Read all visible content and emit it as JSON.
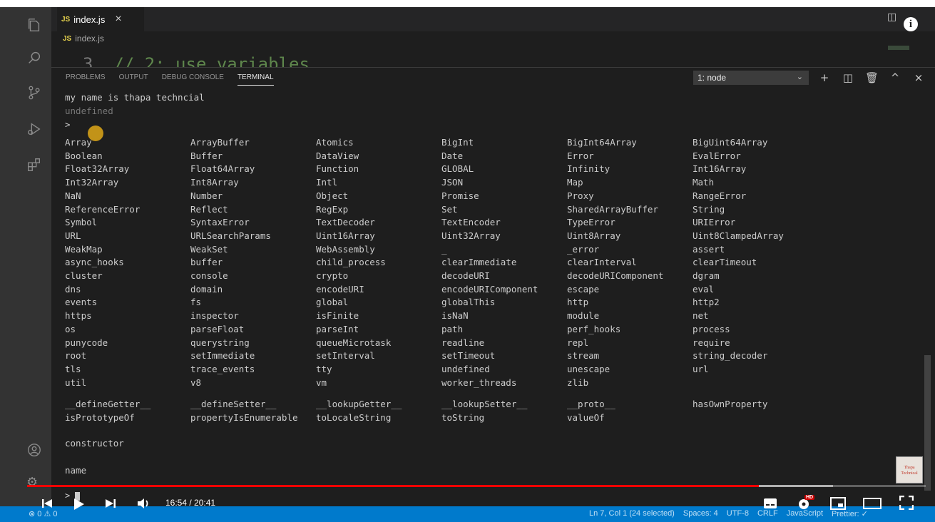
{
  "editor": {
    "tab_label": "index.js",
    "tab_lang_badge": "JS",
    "tab_close": "×",
    "breadcrumb": "index.js",
    "peek_line_number": "3",
    "peek_code": "// 2: use variables"
  },
  "panel": {
    "tabs": [
      "PROBLEMS",
      "OUTPUT",
      "DEBUG CONSOLE",
      "TERMINAL"
    ],
    "active_tab": "TERMINAL",
    "terminal_select": "1: node",
    "actions": [
      "+",
      "split",
      "trash",
      "^",
      "×"
    ]
  },
  "terminal": {
    "output_line": "my name is thapa techncial",
    "undefined_line": "undefined",
    "prompt": ">",
    "completion_grid": [
      [
        "Array",
        "ArrayBuffer",
        "Atomics",
        "BigInt",
        "BigInt64Array",
        "BigUint64Array"
      ],
      [
        "Boolean",
        "Buffer",
        "DataView",
        "Date",
        "Error",
        "EvalError"
      ],
      [
        "Float32Array",
        "Float64Array",
        "Function",
        "GLOBAL",
        "Infinity",
        "Int16Array"
      ],
      [
        "Int32Array",
        "Int8Array",
        "Intl",
        "JSON",
        "Map",
        "Math"
      ],
      [
        "NaN",
        "Number",
        "Object",
        "Promise",
        "Proxy",
        "RangeError"
      ],
      [
        "ReferenceError",
        "Reflect",
        "RegExp",
        "Set",
        "SharedArrayBuffer",
        "String"
      ],
      [
        "Symbol",
        "SyntaxError",
        "TextDecoder",
        "TextEncoder",
        "TypeError",
        "URIError"
      ],
      [
        "URL",
        "URLSearchParams",
        "Uint16Array",
        "Uint32Array",
        "Uint8Array",
        "Uint8ClampedArray"
      ],
      [
        "WeakMap",
        "WeakSet",
        "WebAssembly",
        "_",
        "_error",
        "assert"
      ],
      [
        "async_hooks",
        "buffer",
        "child_process",
        "clearImmediate",
        "clearInterval",
        "clearTimeout"
      ],
      [
        "cluster",
        "console",
        "crypto",
        "decodeURI",
        "decodeURIComponent",
        "dgram"
      ],
      [
        "dns",
        "domain",
        "encodeURI",
        "encodeURIComponent",
        "escape",
        "eval"
      ],
      [
        "events",
        "fs",
        "global",
        "globalThis",
        "http",
        "http2"
      ],
      [
        "https",
        "inspector",
        "isFinite",
        "isNaN",
        "module",
        "net"
      ],
      [
        "os",
        "parseFloat",
        "parseInt",
        "path",
        "perf_hooks",
        "process"
      ],
      [
        "punycode",
        "querystring",
        "queueMicrotask",
        "readline",
        "repl",
        "require"
      ],
      [
        "root",
        "setImmediate",
        "setInterval",
        "setTimeout",
        "stream",
        "string_decoder"
      ],
      [
        "tls",
        "trace_events",
        "tty",
        "undefined",
        "unescape",
        "url"
      ],
      [
        "util",
        "v8",
        "vm",
        "worker_threads",
        "zlib",
        ""
      ]
    ],
    "proto_grid": [
      [
        "__defineGetter__",
        "__defineSetter__",
        "__lookupGetter__",
        "__lookupSetter__",
        "__proto__",
        "hasOwnProperty"
      ],
      [
        "isPrototypeOf",
        "propertyIsEnumerable",
        "toLocaleString",
        "toString",
        "valueOf",
        ""
      ]
    ],
    "constructor_line": "constructor",
    "name_line": "name",
    "bottom_prompt": ">"
  },
  "video": {
    "time": "16:54 / 20:41",
    "progress_fraction": 0.814,
    "buffered_fraction": 0.897,
    "progress_color": "#ff0000",
    "hd_badge": "HD"
  },
  "statusbar": {
    "left": "⊗ 0 ⚠ 0",
    "items": [
      "Ln 7, Col 1 (24 selected)",
      "Spaces: 4",
      "UTF-8",
      "CRLF",
      "JavaScript",
      "Prettier: ✓"
    ]
  },
  "logo_text": "Thapa Technical",
  "colors": {
    "activity_bar": "#333333",
    "editor_bg": "#1e1e1e",
    "statusbar": "#007acc",
    "js_badge": "#e8d44d"
  }
}
